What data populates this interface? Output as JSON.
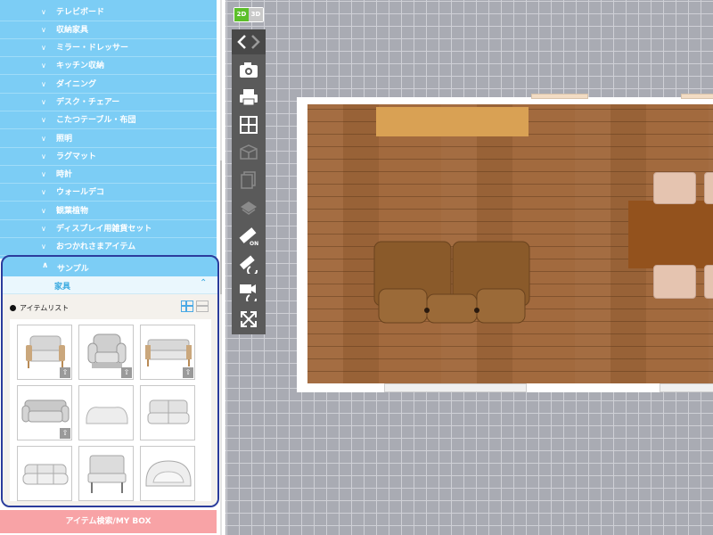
{
  "sidebar": {
    "categories": [
      "テレビボード",
      "収納家具",
      "ミラー・ドレッサー",
      "キッチン収納",
      "ダイニング",
      "デスク・チェアー",
      "こたつテーブル・布団",
      "照明",
      "ラグマット",
      "時計",
      "ウォールデコ",
      "観葉植物",
      "ディスプレイ用雑貨セット",
      "おつかれさまアイテム"
    ],
    "sample": {
      "label": "サンプル",
      "subcategory": "家具",
      "items_title": "アイテムリスト"
    },
    "search_button": "アイテム検索/MY BOX"
  },
  "canvas": {
    "mode_2d": "2D",
    "mode_3d": "3D"
  },
  "colors": {
    "sidebar_bg": "#7ccdf5",
    "accent_border": "#2b3c9c",
    "search_button": "#f8a3a6",
    "mode_active": "#5cbf2a",
    "floor": "#a0673a",
    "table": "#93521d"
  },
  "icons": {
    "toolbar": [
      "undo-icon",
      "redo-icon",
      "camera-icon",
      "print-icon",
      "wall-grid-icon",
      "room-icon",
      "copy-icon",
      "layer-icon",
      "measure-on-icon",
      "measure-rotate-icon",
      "camera-rotate-icon",
      "expand-icon"
    ]
  }
}
